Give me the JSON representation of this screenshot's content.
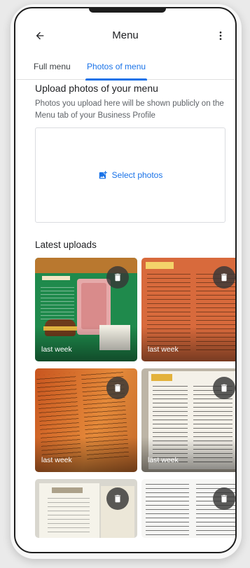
{
  "app_bar": {
    "title": "Menu",
    "back_icon": "arrow-back-icon",
    "more_icon": "more-vert-icon"
  },
  "tabs": [
    {
      "label": "Full menu",
      "selected": false
    },
    {
      "label": "Photos of menu",
      "selected": true
    }
  ],
  "upload": {
    "title": "Upload photos of your menu",
    "description": "Photos you upload here will be shown publicly on the Menu tab of your Business Profile",
    "select_label": "Select photos",
    "select_icon": "add-photo-icon"
  },
  "latest": {
    "title": "Latest uploads",
    "items": [
      {
        "label": "last week",
        "delete_icon": "delete-icon"
      },
      {
        "label": "last week",
        "delete_icon": "delete-icon"
      },
      {
        "label": "last week",
        "delete_icon": "delete-icon"
      },
      {
        "label": "last week",
        "delete_icon": "delete-icon"
      },
      {
        "label": "",
        "delete_icon": "delete-icon"
      },
      {
        "label": "",
        "delete_icon": "delete-icon"
      }
    ]
  },
  "colors": {
    "accent": "#1a73e8",
    "text_primary": "#202124",
    "text_secondary": "#5f6368"
  }
}
